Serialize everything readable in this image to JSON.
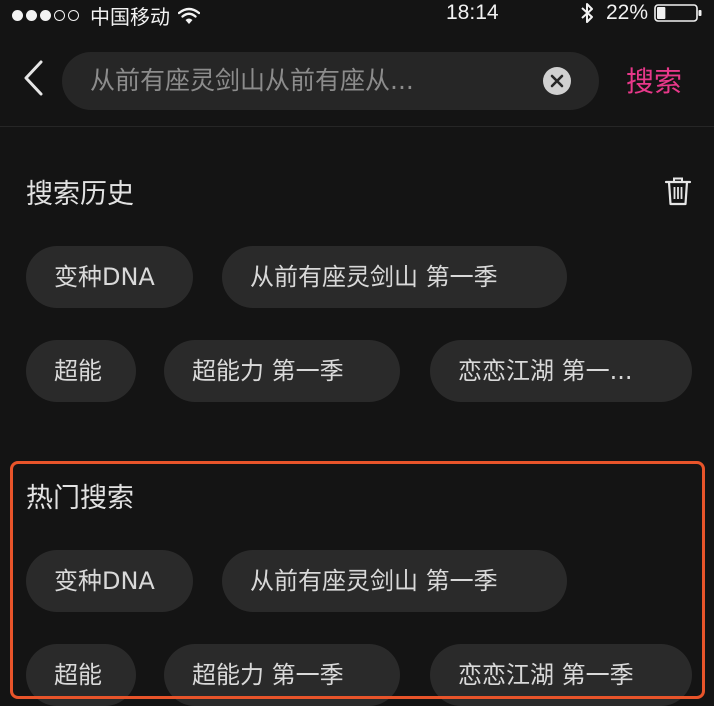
{
  "status_bar": {
    "carrier": "中国移动",
    "time": "18:14",
    "battery": "22%",
    "battery_level": 0.22
  },
  "search": {
    "query": "从前有座灵剑山从前有座从...",
    "submit_label": "搜索"
  },
  "history": {
    "title": "搜索历史",
    "items": [
      "变种DNA",
      "从前有座灵剑山  第一季",
      "超能",
      "超能力  第一季",
      "恋恋江湖  第一..."
    ]
  },
  "hot": {
    "title": "热门搜索",
    "items": [
      "变种DNA",
      "从前有座灵剑山  第一季",
      "超能",
      "超能力  第一季",
      "恋恋江湖  第一季"
    ]
  },
  "colors": {
    "background": "#141414",
    "accent": "#e8388a",
    "chip": "#2a2a2a",
    "highlight": "#e8542a"
  },
  "icons": [
    "signal-icon",
    "wifi-icon",
    "bluetooth-icon",
    "battery-icon",
    "back-icon",
    "clear-icon",
    "trash-icon"
  ]
}
